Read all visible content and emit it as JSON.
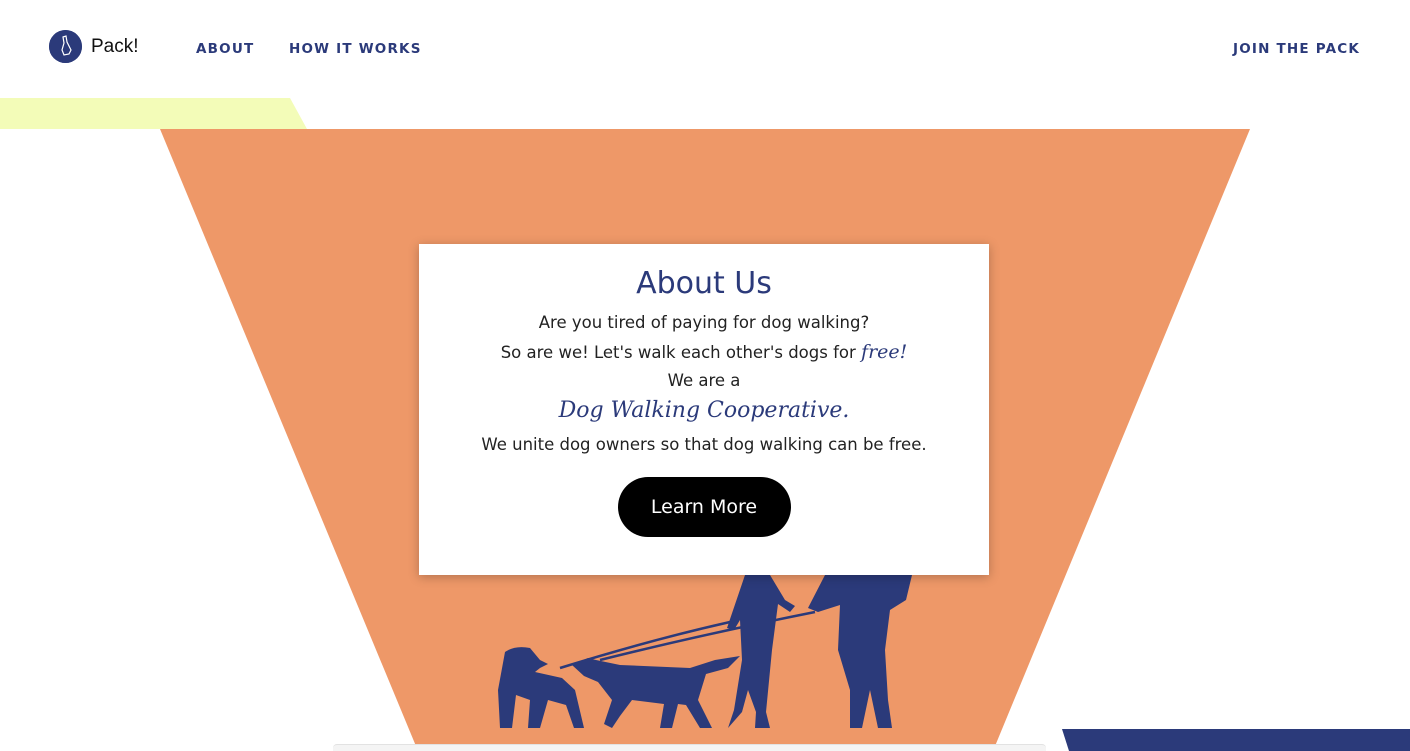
{
  "brand": {
    "name": "Pack!",
    "icon": "dog-head-logo-icon",
    "color": "#2b3a7a"
  },
  "nav": {
    "about": "ABOUT",
    "how_it_works": "HOW IT WORKS",
    "join": "JOIN THE PACK"
  },
  "colors": {
    "accent_orange": "#ee9868",
    "accent_yellow": "#f3fcb8",
    "navy": "#2b3a7a"
  },
  "about": {
    "title": "About Us",
    "line1": "Are you tired of paying for dog walking?",
    "line2": "So are we! Let's walk each other's dogs for ",
    "line2_emphasis": "free!",
    "line3": "We are a",
    "tagline": "Dog Walking Cooperative.",
    "line4": "We unite dog owners so that dog walking can be free.",
    "button": "Learn More"
  },
  "illustration": {
    "icon": "people-walking-dogs-silhouette-icon"
  }
}
